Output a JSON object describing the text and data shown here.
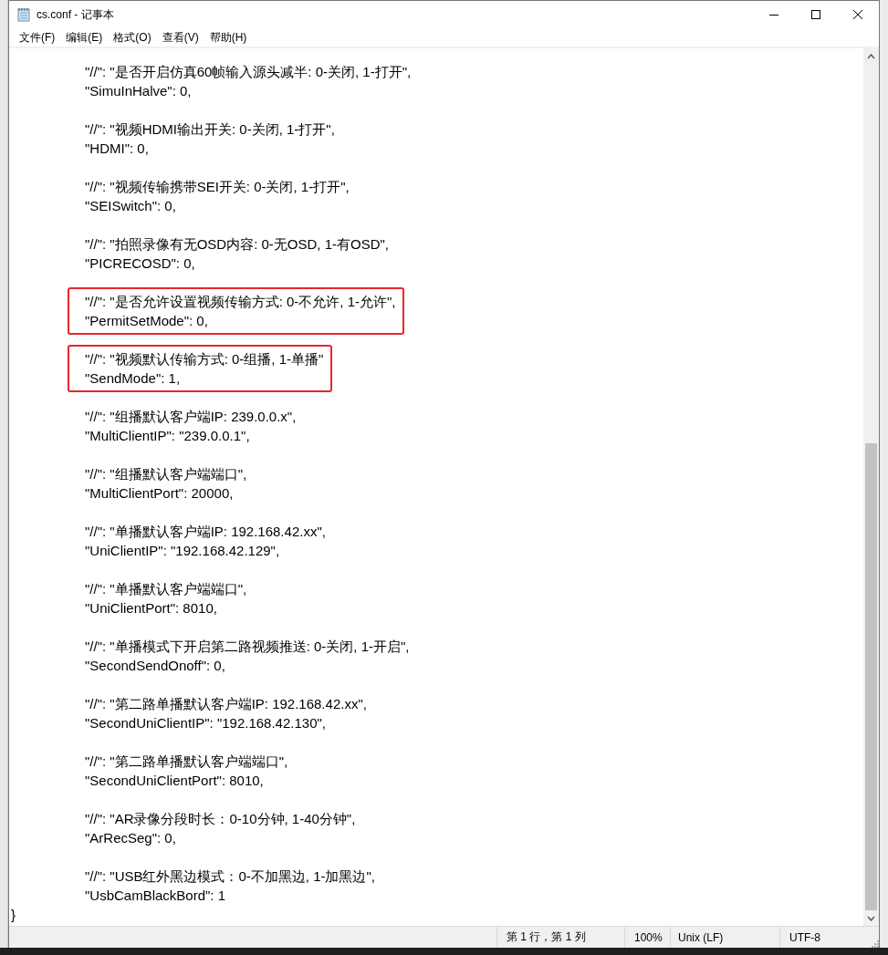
{
  "window": {
    "title": "cs.conf - 记事本"
  },
  "menu": [
    "文件(F)",
    "编辑(E)",
    "格式(O)",
    "查看(V)",
    "帮助(H)"
  ],
  "entries": [
    {
      "comment": "\"//\": \"是否开启仿真60帧输入源头减半: 0-关闭, 1-打开\",",
      "setting": "\"SimuInHalve\": 0,",
      "highlighted": false
    },
    {
      "comment": "\"//\": \"视频HDMI输出开关: 0-关闭, 1-打开\",",
      "setting": "\"HDMI\": 0,",
      "highlighted": false
    },
    {
      "comment": "\"//\": \"视频传输携带SEI开关: 0-关闭, 1-打开\",",
      "setting": "\"SEISwitch\": 0,",
      "highlighted": false
    },
    {
      "comment": "\"//\": \"拍照录像有无OSD内容: 0-无OSD, 1-有OSD\",",
      "setting": "\"PICRECOSD\": 0,",
      "highlighted": false
    },
    {
      "comment": "\"//\": \"是否允许设置视频传输方式: 0-不允许, 1-允许\",",
      "setting": "\"PermitSetMode\": 0,",
      "highlighted": true
    },
    {
      "comment": "\"//\": \"视频默认传输方式: 0-组播, 1-单播\"",
      "setting": "\"SendMode\": 1,",
      "highlighted": true
    },
    {
      "comment": "\"//\": \"组播默认客户端IP: 239.0.0.x\",",
      "setting": "\"MultiClientIP\": \"239.0.0.1\",",
      "highlighted": false
    },
    {
      "comment": "\"//\": \"组播默认客户端端口\",",
      "setting": "\"MultiClientPort\": 20000,",
      "highlighted": false
    },
    {
      "comment": "\"//\": \"单播默认客户端IP: 192.168.42.xx\",",
      "setting": "\"UniClientIP\": \"192.168.42.129\",",
      "highlighted": false
    },
    {
      "comment": "\"//\": \"单播默认客户端端口\",",
      "setting": "\"UniClientPort\": 8010,",
      "highlighted": false
    },
    {
      "comment": "\"//\": \"单播模式下开启第二路视频推送: 0-关闭, 1-开启\",",
      "setting": "\"SecondSendOnoff\": 0,",
      "highlighted": false
    },
    {
      "comment": "\"//\": \"第二路单播默认客户端IP: 192.168.42.xx\",",
      "setting": "\"SecondUniClientIP\": \"192.168.42.130\",",
      "highlighted": false
    },
    {
      "comment": "\"//\": \"第二路单播默认客户端端口\",",
      "setting": "\"SecondUniClientPort\": 8010,",
      "highlighted": false
    },
    {
      "comment": "\"//\": \"AR录像分段时长：0-10分钟, 1-40分钟\",",
      "setting": "\"ArRecSeg\": 0,",
      "highlighted": false
    },
    {
      "comment": "\"//\": \"USB红外黑边模式：0-不加黑边, 1-加黑边\",",
      "setting": "\"UsbCamBlackBord\": 1",
      "highlighted": false
    }
  ],
  "closing_line": "}",
  "status_bar": {
    "position": "第 1 行，第 1 列",
    "zoom": "100%",
    "line_ending": "Unix (LF)",
    "encoding": "UTF-8"
  }
}
